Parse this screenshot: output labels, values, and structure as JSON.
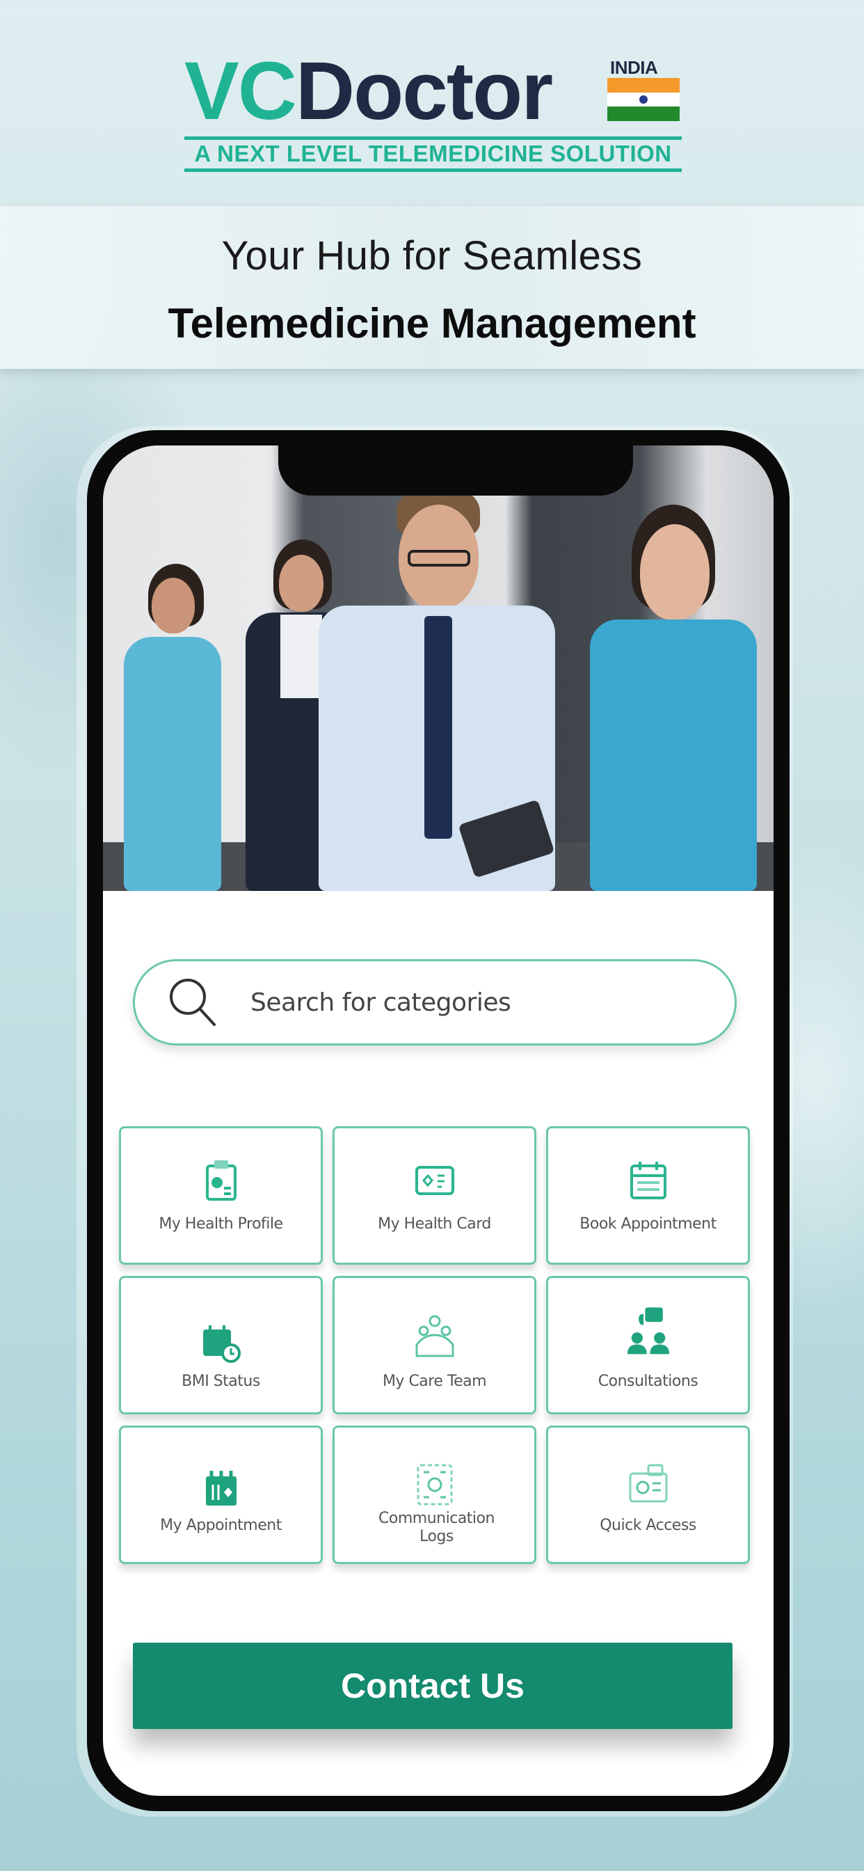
{
  "brand": {
    "logo_vc": "VC",
    "logo_doctor": "Doctor",
    "country_badge": "INDIA",
    "tagline": "A NEXT LEVEL TELEMEDICINE SOLUTION",
    "colors": {
      "teal": "#1fb394",
      "navy": "#1f2a44",
      "button": "#148a6e",
      "tile_border": "#6cc6ae"
    }
  },
  "headline": {
    "line1": "Your Hub for Seamless",
    "line2": "Telemedicine Management"
  },
  "app": {
    "hero_image": "medical team with tablet",
    "search": {
      "placeholder": "Search for categories",
      "value": "",
      "icon": "search-icon"
    },
    "tiles": [
      {
        "label": "My Health Profile",
        "icon": "health-profile-icon"
      },
      {
        "label": "My Health Card",
        "icon": "health-card-icon"
      },
      {
        "label": "Book Appointment",
        "icon": "calendar-icon"
      },
      {
        "label": "BMI Status",
        "icon": "bmi-calendar-clock-icon"
      },
      {
        "label": "My Care Team",
        "icon": "care-team-icon"
      },
      {
        "label": "Consultations",
        "icon": "consultation-icon"
      },
      {
        "label": "My Appointment",
        "icon": "appointment-icon"
      },
      {
        "label": "Communication Logs",
        "icon": "communication-logs-icon"
      },
      {
        "label": "Quick Access",
        "icon": "quick-access-icon"
      }
    ],
    "contact_button": "Contact Us"
  }
}
